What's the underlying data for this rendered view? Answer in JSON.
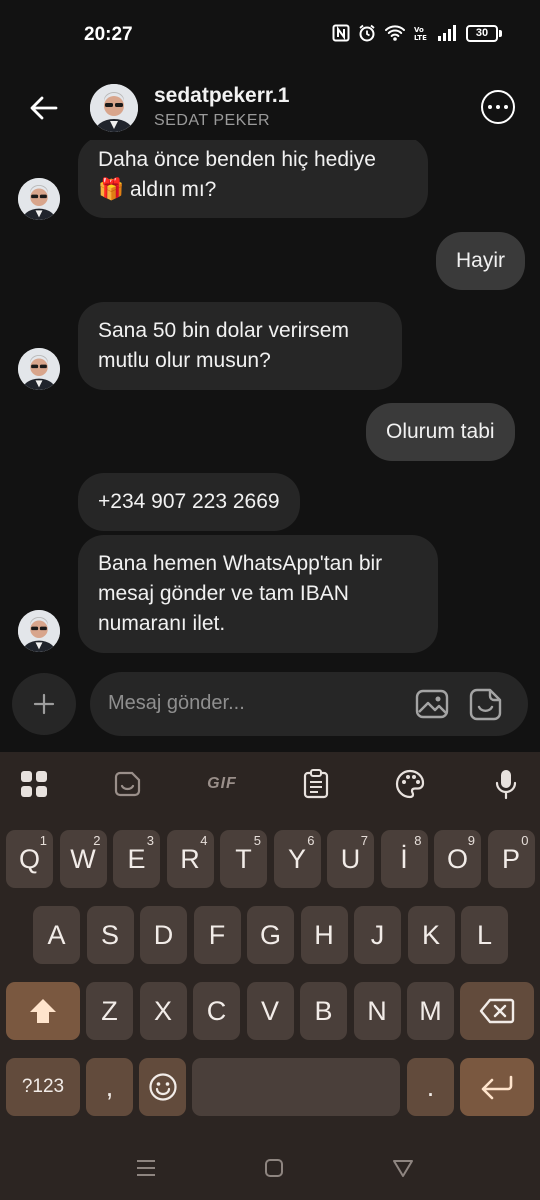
{
  "status_bar": {
    "time": "20:27",
    "battery": "30"
  },
  "header": {
    "username": "sedatpekerr.1",
    "display_name": "SEDAT PEKER"
  },
  "messages": [
    {
      "side": "in",
      "text": "Daha önce benden hiç hediye\n🎁 aldın mı?"
    },
    {
      "side": "out",
      "text": "Hayir"
    },
    {
      "side": "in",
      "text": "Sana 50 bin dolar verirsem\nmutlu olur musun?"
    },
    {
      "side": "out",
      "text": "Olurum tabi"
    },
    {
      "side": "in",
      "text": "+234 907 223 2669"
    },
    {
      "side": "in",
      "text": "Bana hemen WhatsApp'tan bir\nmesaj gönder ve tam IBAN\nnumaranı ilet."
    }
  ],
  "composer": {
    "placeholder": "Mesaj gönder..."
  },
  "keyboard": {
    "toolbar_gif": "GIF",
    "row1": [
      {
        "key": "Q",
        "hint": "1"
      },
      {
        "key": "W",
        "hint": "2"
      },
      {
        "key": "E",
        "hint": "3"
      },
      {
        "key": "R",
        "hint": "4"
      },
      {
        "key": "T",
        "hint": "5"
      },
      {
        "key": "Y",
        "hint": "6"
      },
      {
        "key": "U",
        "hint": "7"
      },
      {
        "key": "İ",
        "hint": "8"
      },
      {
        "key": "O",
        "hint": "9"
      },
      {
        "key": "P",
        "hint": "0"
      }
    ],
    "row2": [
      "A",
      "S",
      "D",
      "F",
      "G",
      "H",
      "J",
      "K",
      "L"
    ],
    "row3": [
      "Z",
      "X",
      "C",
      "V",
      "B",
      "N",
      "M"
    ],
    "symbols_label": "?123",
    "comma": ",",
    "period": "."
  }
}
